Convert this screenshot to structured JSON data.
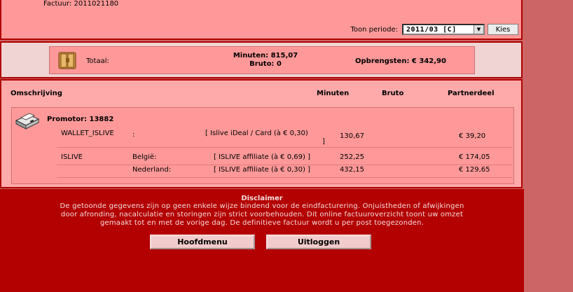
{
  "header": {
    "factuur": "Factuur: 2011021180",
    "periode_label": "Toon periode:",
    "periode_value": "2011/03 [C]",
    "kies_label": "Kies"
  },
  "totaal": {
    "label": "Totaal:",
    "minuten": "Minuten: 815,07",
    "bruto": "Bruto: 0",
    "opbrengsten": "Opbrengsten: € 342,90",
    "icon": "wallet-icon"
  },
  "columns": {
    "omschrijving": "Omschrijving",
    "minuten": "Minuten",
    "bruto": "Bruto",
    "partnerdeel": "Partnerdeel"
  },
  "promotor": {
    "title": "Promotor: 13882",
    "icon": "printer-icon",
    "rows": [
      {
        "name": "WALLET_ISLIVE",
        "country": ":",
        "tariff_line1": "[ Islive iDeal / Card (à € 0,30)",
        "tariff_line2": "]",
        "minuten": "130,67",
        "partnerdeel": "€ 39,20"
      },
      {
        "name": "ISLIVE",
        "country": "België:",
        "tariff_line1": "[ ISLIVE affiliate (à € 0,69) ]",
        "minuten": "252,25",
        "partnerdeel": "€ 174,05"
      },
      {
        "name": "",
        "country": "Nederland:",
        "tariff_line1": "[ ISLIVE affiliate (à € 0,30) ]",
        "minuten": "432,15",
        "partnerdeel": "€ 129,65"
      }
    ]
  },
  "disclaimer": {
    "title": "Disclaimer",
    "text": "De getoonde gegevens zijn op geen enkele wijze bindend voor de eindfacturering. Onjuistheden of afwijkingen door afronding, nacalculatie en storingen zijn strict voorbehouden. Dit online factuuroverzicht toont uw omzet gemaakt tot en met de vorige dag. De definitieve factuur wordt u per post toegezonden."
  },
  "buttons": {
    "hoofdmenu": "Hoofdmenu",
    "uitloggen": "Uitloggen"
  },
  "colors": {
    "panel": "#ff9999",
    "border": "#b00000",
    "footer": "#b30000",
    "side": "#cc6666"
  }
}
